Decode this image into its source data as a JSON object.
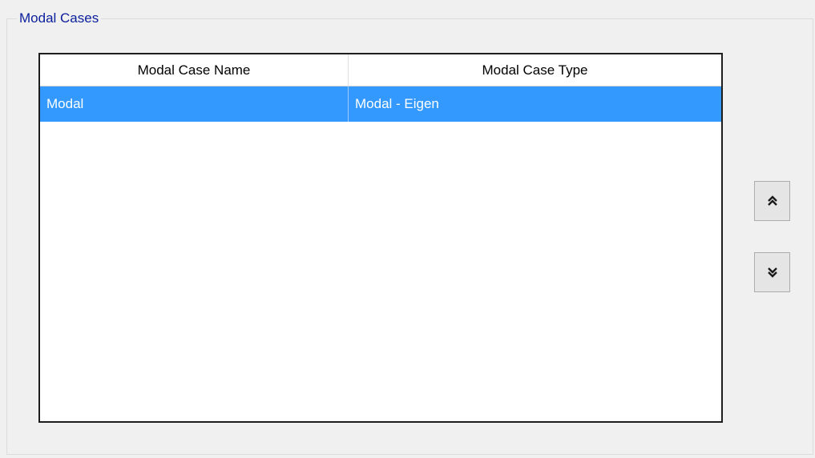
{
  "group": {
    "title": "Modal Cases"
  },
  "grid": {
    "columns": [
      "Modal Case Name",
      "Modal Case Type"
    ],
    "rows": [
      {
        "name": "Modal",
        "type": "Modal - Eigen",
        "selected": true
      }
    ]
  },
  "buttons": {
    "move_up_icon": "double-chevron-up-icon",
    "move_down_icon": "double-chevron-down-icon"
  },
  "colors": {
    "selection": "#3399ff",
    "group_title": "#0a1e9c"
  }
}
